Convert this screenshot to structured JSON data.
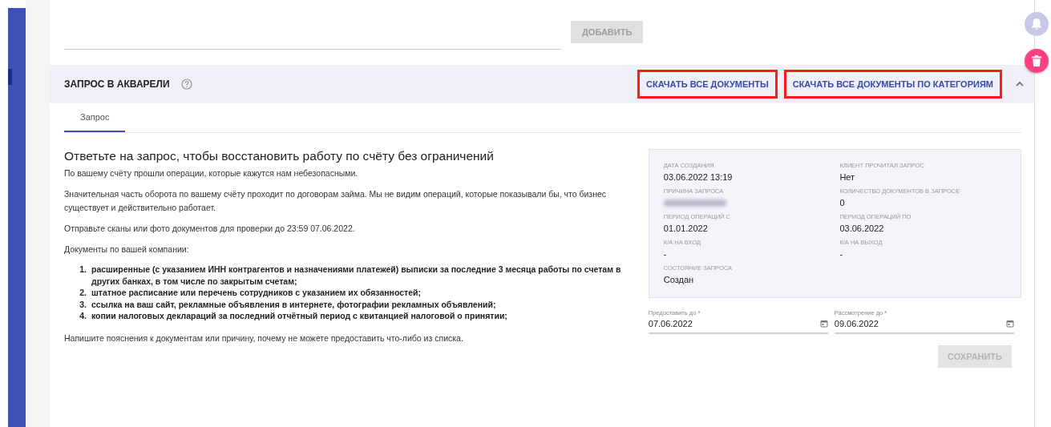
{
  "top_form": {
    "add_button": "ДОБАВИТЬ"
  },
  "section": {
    "title": "ЗАПРОС В АКВАРЕЛИ",
    "links": [
      {
        "label": "СКАЧАТЬ ВСЕ ДОКУМЕНТЫ",
        "outlined": true
      },
      {
        "label": "СКАЧАТЬ ВСЕ ДОКУМЕНТЫ ПО КАТЕГОРИЯМ",
        "outlined": true
      }
    ],
    "expanded": true
  },
  "tabs": [
    {
      "label": "Запрос",
      "selected": true
    }
  ],
  "request": {
    "heading": "Ответьте на запрос, чтобы восстановить работу по счёту без ограничений",
    "paragraphs": [
      "По вашему счёту прошли операции, которые кажутся нам небезопасными.",
      "Значительная часть оборота по вашему счёту проходит по договорам займа. Мы не видим операций, которые показывали бы, что бизнес существует и действительно работает.",
      "Отправьте сканы или фото документов для проверки до 23:59 07.06.2022.",
      "Документы по вашей компании:"
    ],
    "documents": [
      {
        "number": "1.",
        "text": "расширенные (с указанием ИНН контрагентов и назначениями платежей) выписки за последние 3 месяца работы по счетам в других банках, в том числе по закрытым счетам;"
      },
      {
        "number": "2.",
        "text": "штатное расписание или перечень сотрудников с указанием их обязанностей;"
      },
      {
        "number": "3.",
        "text": "ссылка на ваш сайт, рекламные объявления в интернете, фотографии рекламных объявлений;"
      },
      {
        "number": "4.",
        "text": "копии налоговых деклараций за последний отчётный период с квитанцией налоговой о принятии;"
      }
    ],
    "footer": "Напишите пояснения к документам или причину, почему не можете предоставить что-либо из списка."
  },
  "info": [
    {
      "label": "ДАТА СОЗДАНИЯ",
      "value": "03.06.2022 13:19"
    },
    {
      "label": "КЛИЕНТ ПРОЧИТАЛ ЗАПРОС",
      "value": "Нет"
    },
    {
      "label": "ПРИЧИНА ЗАПРОСА",
      "blurred": true
    },
    {
      "label": "КОЛИЧЕСТВО ДОКУМЕНТОВ В ЗАПРОСЕ",
      "value": "0"
    },
    {
      "label": "ПЕРИОД ОПЕРАЦИЙ С",
      "value": "01.01.2022"
    },
    {
      "label": "ПЕРИОД ОПЕРАЦИЙ ПО",
      "value": "03.06.2022"
    },
    {
      "label": "К/А НА ВХОД",
      "value": "-"
    },
    {
      "label": "К/А НА ВЫХОД",
      "value": "-"
    },
    {
      "label": "СОСТОЯНИЕ ЗАПРОСА",
      "value": "Создан"
    }
  ],
  "dates": [
    {
      "label": "Предоставить до *",
      "value": "07.06.2022"
    },
    {
      "label": "Рассмотрение до *",
      "value": "09.06.2022"
    }
  ],
  "save_button": {
    "label": "СОХРАНИТЬ",
    "disabled": true
  }
}
